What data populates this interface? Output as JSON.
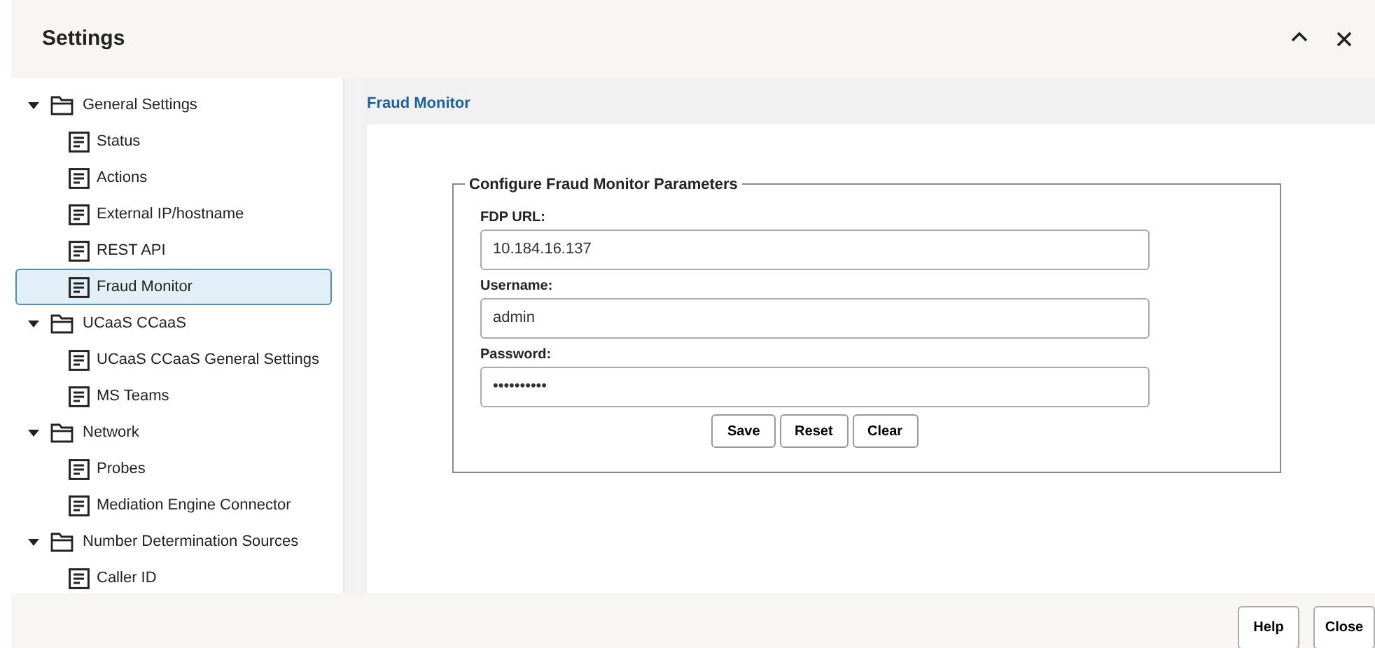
{
  "window": {
    "title": "Settings",
    "controls": [
      {
        "kind": "collapse"
      },
      {
        "kind": "close"
      }
    ]
  },
  "sidebar": {
    "items": [
      {
        "label": "General Settings",
        "expanded": true,
        "selected": false,
        "children": [
          {
            "label": "Status",
            "selected": false
          },
          {
            "label": "Actions",
            "selected": false
          },
          {
            "label": "External IP/hostname",
            "selected": false
          },
          {
            "label": "REST API",
            "selected": false
          },
          {
            "label": "Fraud Monitor",
            "selected": true
          }
        ]
      },
      {
        "label": "UCaaS CCaaS",
        "expanded": true,
        "selected": false,
        "children": [
          {
            "label": "UCaaS CCaaS General Settings",
            "selected": false
          },
          {
            "label": "MS Teams",
            "selected": false
          }
        ]
      },
      {
        "label": "Network",
        "expanded": true,
        "selected": false,
        "children": [
          {
            "label": "Probes",
            "selected": false
          },
          {
            "label": "Mediation Engine Connector",
            "selected": false
          }
        ]
      },
      {
        "label": "Number Determination Sources",
        "expanded": true,
        "selected": false,
        "children": [
          {
            "label": "Caller ID",
            "selected": false
          }
        ]
      }
    ]
  },
  "panel": {
    "title": "Fraud Monitor",
    "form": {
      "legend": "Configure Fraud Monitor Parameters",
      "fields": [
        {
          "label": "FDP URL:",
          "value": "10.184.16.137"
        },
        {
          "label": "Username:",
          "value": "admin"
        },
        {
          "label": "Password:",
          "value": "••••••••••"
        }
      ],
      "buttons": [
        "Save",
        "Reset",
        "Clear"
      ]
    }
  },
  "footer": {
    "buttons": [
      "Help",
      "Close"
    ]
  }
}
